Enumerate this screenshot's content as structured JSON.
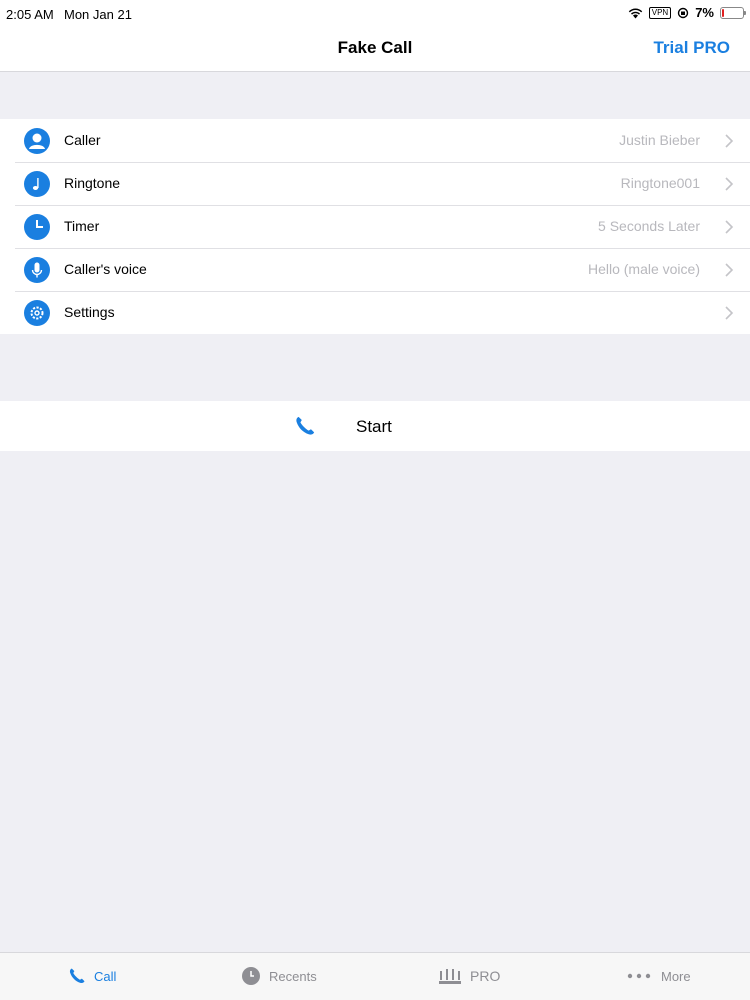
{
  "status_bar": {
    "time": "2:05 AM",
    "date": "Mon Jan 21",
    "vpn": "VPN",
    "battery": "7%",
    "battery_level": 0.07
  },
  "nav": {
    "title": "Fake Call",
    "action": "Trial PRO"
  },
  "rows": [
    {
      "label": "Caller",
      "value": "Justin Bieber",
      "icon": "person-icon"
    },
    {
      "label": "Ringtone",
      "value": "Ringtone001",
      "icon": "music-note-icon"
    },
    {
      "label": "Timer",
      "value": "5 Seconds Later",
      "icon": "clock-icon"
    },
    {
      "label": "Caller's voice",
      "value": "Hello (male voice)",
      "icon": "microphone-icon"
    },
    {
      "label": "Settings",
      "value": "",
      "icon": "gear-icon"
    }
  ],
  "start": {
    "label": "Start",
    "icon": "phone-icon"
  },
  "tabs": [
    {
      "label": "Call",
      "icon": "phone-icon",
      "active": true
    },
    {
      "label": "Recents",
      "icon": "clock-icon",
      "active": false
    },
    {
      "label": "PRO",
      "icon": "crown-icon",
      "active": false
    },
    {
      "label": "More",
      "icon": "ellipsis-icon",
      "active": false
    }
  ],
  "colors": {
    "accent": "#1a7fe0",
    "background": "#efeff4",
    "secondary_text": "#b8b8bd",
    "battery_low": "#e02020"
  }
}
